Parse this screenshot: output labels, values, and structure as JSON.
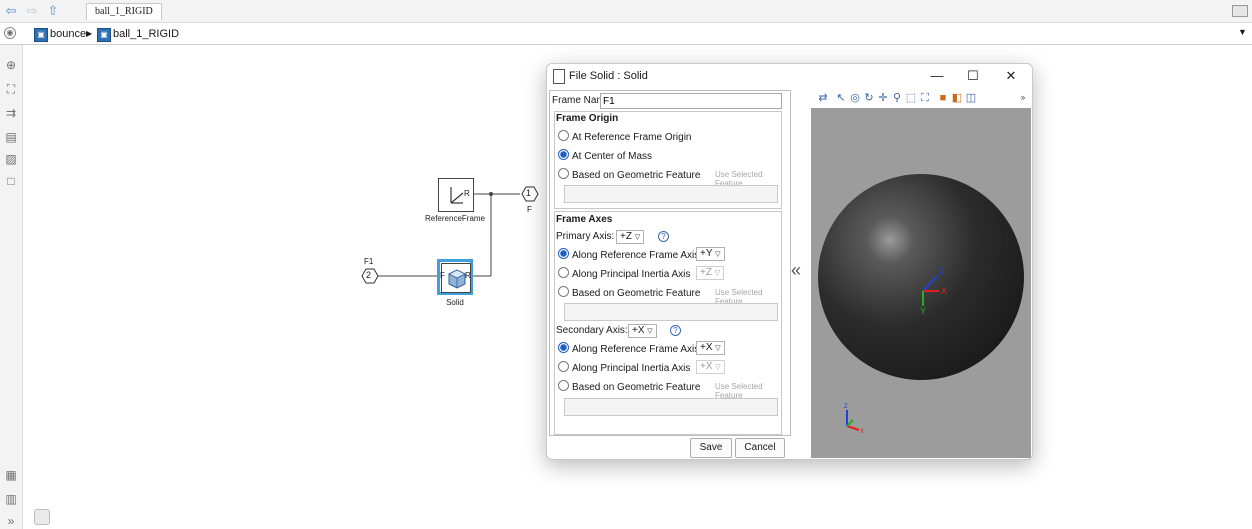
{
  "window": {
    "tab_title": "ball_1_RIGID"
  },
  "breadcrumb": {
    "items": [
      "bounce",
      "ball_1_RIGID"
    ],
    "separator": "▶"
  },
  "canvas": {
    "blocks": {
      "reference_frame": {
        "label": "ReferenceFrame",
        "port": "R"
      },
      "solid": {
        "label": "Solid",
        "port_left": "F",
        "port_right": "R"
      }
    },
    "ports": {
      "out1": {
        "number": "1",
        "label": "F"
      },
      "in2": {
        "number": "2",
        "label": "F1"
      }
    }
  },
  "dialog": {
    "title": "File Solid : Solid",
    "frame_name_label": "Frame Name:",
    "frame_name_value": "F1",
    "frame_origin": {
      "title": "Frame Origin",
      "opt1": "At Reference Frame Origin",
      "opt2": "At Center of Mass",
      "opt3": "Based on Geometric Feature",
      "use_selected": "Use Selected Feature",
      "selected": "At Center of Mass"
    },
    "frame_axes": {
      "title": "Frame Axes",
      "primary_label": "Primary Axis:",
      "primary_value": "+Z",
      "primary_opt1": "Along Reference Frame Axis",
      "primary_opt1_value": "+Y",
      "primary_opt2": "Along Principal Inertia Axis",
      "primary_opt2_value": "+Z",
      "primary_opt3": "Based on Geometric Feature",
      "use_selected": "Use Selected Feature",
      "secondary_label": "Secondary Axis:",
      "secondary_value": "+X",
      "secondary_opt1": "Along Reference Frame Axis",
      "secondary_opt1_value": "+X",
      "secondary_opt2": "Along Principal Inertia Axis",
      "secondary_opt2_value": "+X",
      "secondary_opt3": "Based on Geometric Feature"
    },
    "buttons": {
      "save": "Save",
      "cancel": "Cancel"
    },
    "collapse": "«",
    "axes_labels": {
      "x": "X",
      "y": "Y",
      "z": "Z"
    }
  },
  "colors": {
    "accent": "#1f5fbf",
    "selected_block": "#3fa0dc",
    "axis_x": "#e02020",
    "axis_y": "#20b020",
    "axis_z": "#2040e0"
  }
}
